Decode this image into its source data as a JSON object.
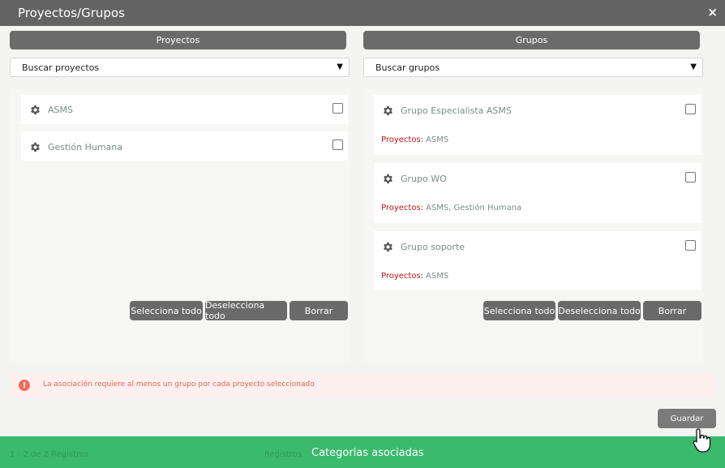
{
  "window": {
    "title": "Proyectos/Grupos",
    "close_label": "×"
  },
  "projects": {
    "header": "Proyectos",
    "search_placeholder": "Buscar proyectos",
    "items": [
      {
        "label": "ASMS",
        "checked": false
      },
      {
        "label": "Gestión Humana",
        "checked": false
      }
    ],
    "buttons": {
      "select_all": "Selecciona todo",
      "deselect_all": "Deselecciona todo",
      "clear": "Borrar"
    }
  },
  "groups": {
    "header": "Grupos",
    "search_placeholder": "Buscar grupos",
    "items": [
      {
        "label": "Grupo Especialista ASMS",
        "projects_key": "Proyectos:",
        "projects_value": "ASMS",
        "checked": false
      },
      {
        "label": "Grupo WO",
        "projects_key": "Proyectos:",
        "projects_value": "ASMS, Gestión Humana",
        "checked": false
      },
      {
        "label": "Grupo soporte",
        "projects_key": "Proyectos:",
        "projects_value": "ASMS",
        "checked": false
      }
    ],
    "buttons": {
      "select_all": "Selecciona todo",
      "deselect_all": "Deselecciona todo",
      "clear": "Borrar"
    }
  },
  "alert": {
    "icon": "!",
    "message": "La asociación requiere al menos un grupo por cada proyecto seleccionado"
  },
  "save_label": "Guardar",
  "footer": {
    "label": "Categorias asociadas",
    "background_text_left": "1 - 2 de 2 Registros",
    "background_text_center": "Registros"
  },
  "colors": {
    "footer": "#3bb96d",
    "titlebar": "#636363",
    "alert_text": "#e4685a",
    "projects_key": "#c0141b"
  }
}
